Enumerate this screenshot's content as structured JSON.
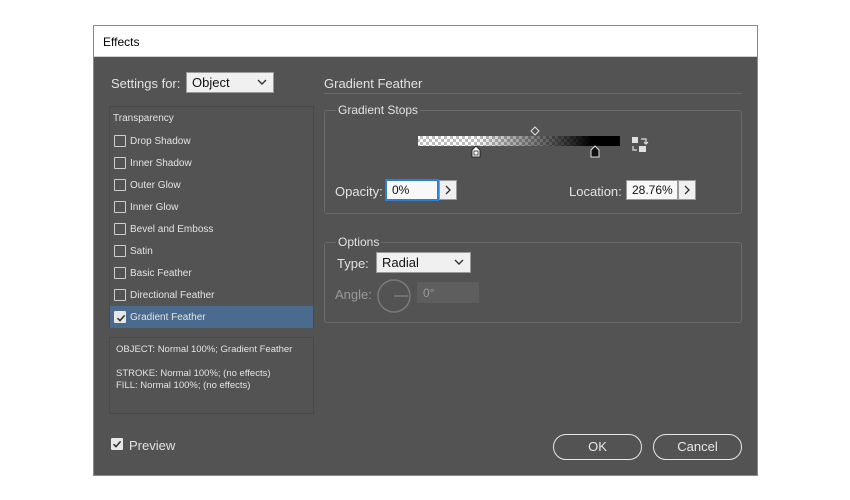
{
  "dialog": {
    "title": "Effects"
  },
  "settings_for": {
    "label": "Settings for:",
    "value": "Object"
  },
  "effects_list": {
    "header": "Transparency",
    "items": [
      {
        "label": "Drop Shadow",
        "checked": false
      },
      {
        "label": "Inner Shadow",
        "checked": false
      },
      {
        "label": "Outer Glow",
        "checked": false
      },
      {
        "label": "Inner Glow",
        "checked": false
      },
      {
        "label": "Bevel and Emboss",
        "checked": false
      },
      {
        "label": "Satin",
        "checked": false
      },
      {
        "label": "Basic Feather",
        "checked": false
      },
      {
        "label": "Directional Feather",
        "checked": false
      },
      {
        "label": "Gradient Feather",
        "checked": true,
        "selected": true
      }
    ]
  },
  "summary": {
    "object": "OBJECT: Normal 100%; Gradient Feather",
    "stroke": "STROKE: Normal 100%; (no effects)",
    "fill": "FILL: Normal 100%; (no effects)"
  },
  "panel": {
    "title": "Gradient Feather",
    "gradient_stops": {
      "title": "Gradient Stops",
      "opacity_label": "Opacity:",
      "opacity_value": "0%",
      "location_label": "Location:",
      "location_value": "28.76%"
    },
    "options": {
      "title": "Options",
      "type_label": "Type:",
      "type_value": "Radial",
      "angle_label": "Angle:",
      "angle_value": "0°"
    }
  },
  "preview": {
    "label": "Preview",
    "checked": true
  },
  "buttons": {
    "ok": "OK",
    "cancel": "Cancel"
  },
  "colors": {
    "dialog_bg": "#535353",
    "selection": "#4b6b8e",
    "focus": "#2d7fd6"
  }
}
